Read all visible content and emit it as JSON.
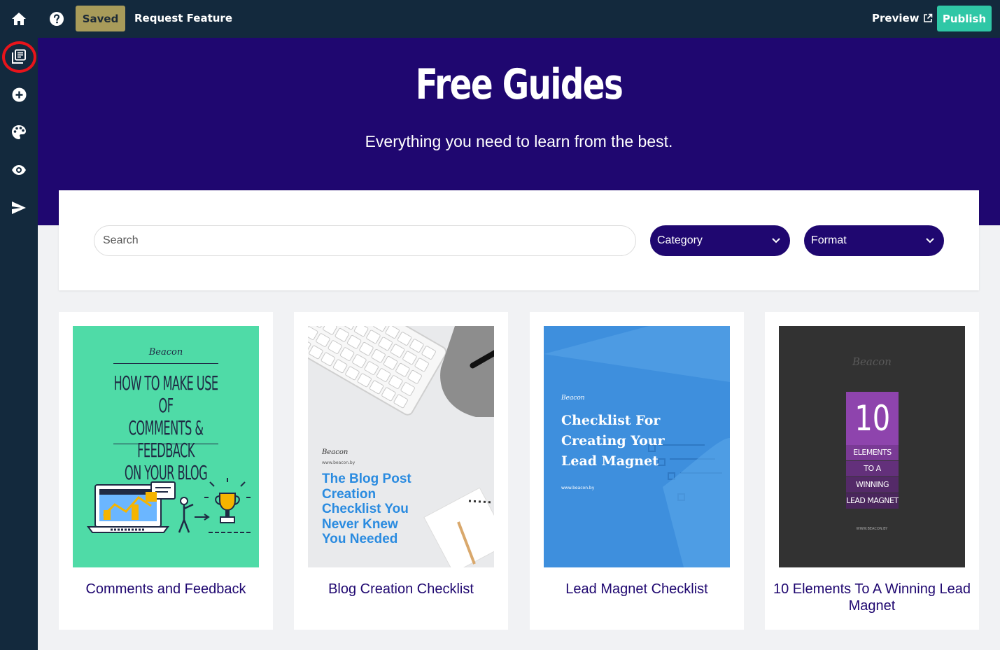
{
  "topbar": {
    "saved_label": "Saved",
    "request_feature_label": "Request Feature",
    "preview_label": "Preview",
    "publish_label": "Publish"
  },
  "sidebar": {
    "items": [
      {
        "name": "guides",
        "icon": "library-icon"
      },
      {
        "name": "add",
        "icon": "add-circle-icon"
      },
      {
        "name": "design",
        "icon": "palette-icon"
      },
      {
        "name": "preview",
        "icon": "eye-icon"
      },
      {
        "name": "send",
        "icon": "send-icon"
      }
    ]
  },
  "hero": {
    "title": "Free Guides",
    "subtitle": "Everything you need to learn from the best."
  },
  "filters": {
    "search_placeholder": "Search",
    "category_label": "Category",
    "format_label": "Format"
  },
  "colors": {
    "topbar": "#13293d",
    "hero": "#1f0770",
    "saved": "#a89b5a",
    "publish": "#2fc7a6",
    "card_title": "#1f0770"
  },
  "cards": [
    {
      "title": "Comments and Feedback",
      "cover": {
        "brand": "Beacon",
        "headline": [
          "HOW TO MAKE USE OF",
          "COMMENTS & FEEDBACK",
          "ON YOUR BLOG"
        ]
      }
    },
    {
      "title": "Blog Creation Checklist",
      "cover": {
        "brand": "Beacon",
        "url": "www.beacon.by",
        "headline": [
          "The Blog Post",
          "Creation",
          "Checklist You",
          "Never Knew",
          "You Needed"
        ]
      }
    },
    {
      "title": "Lead Magnet Checklist",
      "cover": {
        "brand": "Beacon",
        "headline": [
          "Checklist For",
          "Creating Your",
          "Lead Magnet"
        ],
        "url": "www.beacon.by"
      }
    },
    {
      "title": "10 Elements To A Winning Lead Magnet",
      "cover": {
        "brand": "Beacon",
        "number": "10",
        "rows": [
          "ELEMENTS",
          "TO A",
          "WINNING",
          "LEAD MAGNET"
        ],
        "url": "WWW.BEACON.BY"
      }
    }
  ]
}
